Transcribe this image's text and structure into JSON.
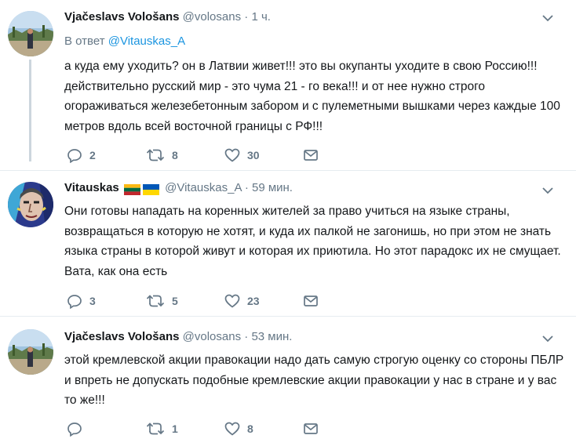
{
  "tweets": [
    {
      "author_name": "Vjačeslavs Vološans",
      "author_handle": "@volosans",
      "separator": "·",
      "time": "1 ч.",
      "reply_prefix": "В ответ",
      "reply_to": "@Vitauskas_A",
      "text": "а куда ему уходить? он в Латвии живет!!! это вы окупанты уходите в свою Россию!!! действительно русский мир - это чума 21 - го века!!! и от нее нужно строго огораживаться железебетонным забором и с пулеметными вышками через каждые 100 метров вдоль всей восточной границы с РФ!!!",
      "replies": "2",
      "retweets": "8",
      "likes": "30"
    },
    {
      "author_name": "Vitauskas",
      "author_handle": "@Vitauskas_A",
      "flags": [
        "lithuania-flag",
        "ukraine-flag"
      ],
      "separator": "·",
      "time": "59 мин.",
      "text": "Они готовы нападать на коренных жителей за право учиться на языке страны, возвращаться в которую не хотят, и куда их палкой не загонишь, но при этом не знать языка страны в которой живут и которая их приютила. Но этот парадокс их не смущает. Вата, как она есть",
      "replies": "3",
      "retweets": "5",
      "likes": "23"
    },
    {
      "author_name": "Vjačeslavs Vološans",
      "author_handle": "@volosans",
      "separator": "·",
      "time": "53 мин.",
      "text": "этой кремлевской акции правокации надо дать самую строгую оценку со стороны ПБЛР и впреть не допускать подобные кремлевские акции правокации у нас в стране и у вас то же!!!",
      "replies": "",
      "retweets": "1",
      "likes": "8"
    }
  ],
  "colors": {
    "text": "#14171a",
    "secondary": "#657786",
    "link": "#1b95e0",
    "thread_line": "#ccd6dd",
    "divider": "#e6ecf0"
  }
}
